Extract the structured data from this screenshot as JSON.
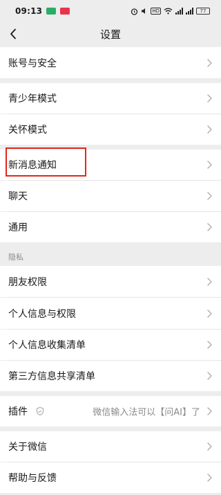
{
  "status_bar": {
    "time": "09:13",
    "hd_label": "HD",
    "battery": "77",
    "app_icon_colors": [
      "#2aae67",
      "#e8334a"
    ]
  },
  "nav": {
    "title": "设置",
    "back_icon": "chevron-left-icon"
  },
  "sections": {
    "account": "账号与安全",
    "youth_mode": "青少年模式",
    "care_mode": "关怀模式",
    "new_message_notification": "新消息通知",
    "chat": "聊天",
    "general": "通用",
    "privacy_header": "隐私",
    "friend_permissions": "朋友权限",
    "personal_info_permissions": "个人信息与权限",
    "personal_info_collection": "个人信息收集清单",
    "third_party_sharing": "第三方信息共享清单",
    "plugins_label": "插件",
    "plugins_value": "微信输入法可以【问AI】了",
    "about_wechat": "关于微信",
    "help_feedback": "帮助与反馈"
  },
  "colors": {
    "background": "#ededed",
    "cell": "#ffffff",
    "highlight": "#e3261b",
    "secondary_text": "#8a8a8a"
  }
}
